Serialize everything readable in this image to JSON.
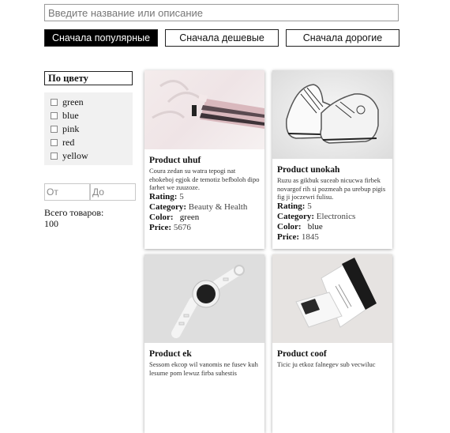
{
  "search": {
    "placeholder": "Введите название или описание"
  },
  "sort": {
    "popular": "Сначала популярные",
    "cheap": "Сначала дешевые",
    "expensive": "Сначала дорогие"
  },
  "filters": {
    "title": "По цвету",
    "colors": [
      "green",
      "blue",
      "pink",
      "red",
      "yellow"
    ],
    "price_from_placeholder": "От",
    "price_to_placeholder": "До"
  },
  "total": {
    "label": "Всего товаров:",
    "count": "100"
  },
  "labels": {
    "rating": "Rating:",
    "category": "Category:",
    "color": "Color:",
    "price": "Price:"
  },
  "products": [
    {
      "name": "Product uhuf",
      "description": "Coura zedan su watra tepogi nat ehokeboj egjok de temotiz befboloh dipo farhet we zuuzoze.",
      "rating": "5",
      "category": "Beauty & Health",
      "color": "green",
      "price": "5676"
    },
    {
      "name": "Product unokah",
      "description": "Ruzu as gikbuk suceab nicucwa firbek novargof rih si pozmeah pa urebup pigis fig ji joczewri fulisu.",
      "rating": "5",
      "category": "Electronics",
      "color": "blue",
      "price": "1845"
    },
    {
      "name": "Product ek",
      "description": "Sessom ekcop wil vanomis ne fusev kuh lesume pom lewuz firba suhestis"
    },
    {
      "name": "Product coof",
      "description": "Ticic ju etkoz falnegev sub vecwiluc"
    }
  ]
}
